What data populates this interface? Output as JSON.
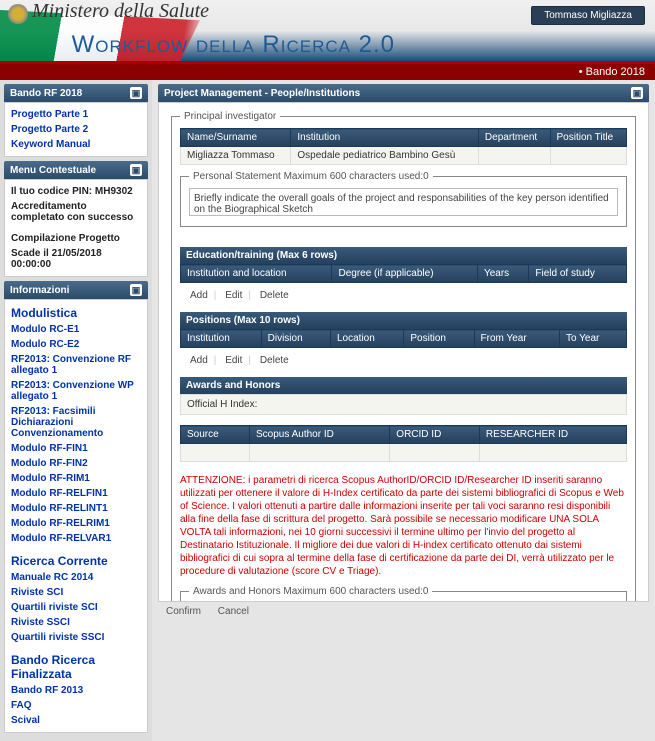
{
  "header": {
    "ministry": "Ministero della Salute",
    "user": "Tommaso Migliazza",
    "app_title": "Workflow della Ricerca 2.0",
    "bando_label": "• Bando 2018"
  },
  "sidebar": {
    "panel1": {
      "title": "Bando RF 2018",
      "items": [
        "Progetto Parte 1",
        "Progetto Parte 2",
        "Keyword Manual"
      ]
    },
    "panel2": {
      "title": "Menu Contestuale",
      "pin_line": "Il tuo codice PIN: MH9302",
      "acc_line": "Accreditamento completato con successo",
      "comp_line": "Compilazione Progetto",
      "deadline": "Scade il 21/05/2018 00:00:00"
    },
    "panel3": {
      "title": "Informazioni",
      "modulistica_heading": "Modulistica",
      "modulistica": [
        "Modulo RC-E1",
        "Modulo RC-E2",
        "RF2013: Convenzione RF allegato 1",
        "RF2013: Convenzione WP allegato 1",
        "RF2013: Facsimili Dichiarazioni Convenzionamento",
        "Modulo RF-FIN1",
        "Modulo RF-FIN2",
        "Modulo RF-RIM1",
        "Modulo RF-RELFIN1",
        "Modulo RF-RELINT1",
        "Modulo RF-RELRIM1",
        "Modulo RF-RELVAR1"
      ],
      "ricerca_heading": "Ricerca Corrente",
      "ricerca": [
        "Manuale RC 2014",
        "Riviste SCI",
        "Quartili riviste SCI",
        "Riviste SSCI",
        "Quartili riviste SSCI"
      ],
      "bando_heading": "Bando Ricerca Finalizzata",
      "bando_items": [
        "Bando RF 2013",
        "FAQ",
        "Scival"
      ]
    }
  },
  "main": {
    "panel_title": "Project Management - People/Institutions",
    "pi_legend": "Principal investigator",
    "pi_headers": [
      "Name/Surname",
      "Institution",
      "Department",
      "Position Title"
    ],
    "pi_row": {
      "name": "Migliazza Tommaso",
      "institution": "Ospedale pediatrico Bambino Gesù",
      "department": "",
      "position": ""
    },
    "ps_legend": "Personal Statement Maximum 600 characters used:0",
    "ps_text": "Briefly indicate the overall goals of the project and responsabilities of the key person identified on the Biographical Sketch",
    "edu_title": "Education/training (Max 6 rows)",
    "edu_headers": [
      "Institution and location",
      "Degree (if applicable)",
      "Years",
      "Field of study"
    ],
    "tool_add": "Add",
    "tool_edit": "Edit",
    "tool_delete": "Delete",
    "pos_title": "Positions (Max 10 rows)",
    "pos_headers": [
      "Institution",
      "Division",
      "Location",
      "Position",
      "From Year",
      "To Year"
    ],
    "awards_title": "Awards and Honors",
    "hindex_label": "Official H Index:",
    "ids_headers": [
      "Source",
      "Scopus Author ID",
      "ORCID ID",
      "RESEARCHER ID"
    ],
    "warn_prefix": "ATTENZIONE:",
    "warn_text": " i parametri di ricerca Scopus AuthorID/ORCID ID/Researcher ID inseriti saranno utilizzati per ottenere il valore di H-Index certificato da parte dei sistemi bibliografici di Scopus e Web of Science.\nI valori ottenuti a partire dalle informazioni inserite per tali voci saranno resi disponibili alla fine della fase di scrittura del progetto.\nSarà possibile se necessario modificare UNA SOLA VOLTA tali informazioni, nei 10 giorni successivi il termine ultimo per l'invio del progetto al Destinatario Istituzionale.\nIl migliore dei due valori di H-index certificato ottenuto dai sistemi bibliografici di cui sopra al termine della fase di certificazione da parte dei DI, verrà utilizzato per le procedure di valutazione (score CV e Triage).",
    "ah_legend": "Awards and Honors Maximum 600 characters used:0",
    "confirm": "Confirm",
    "cancel": "Cancel"
  }
}
